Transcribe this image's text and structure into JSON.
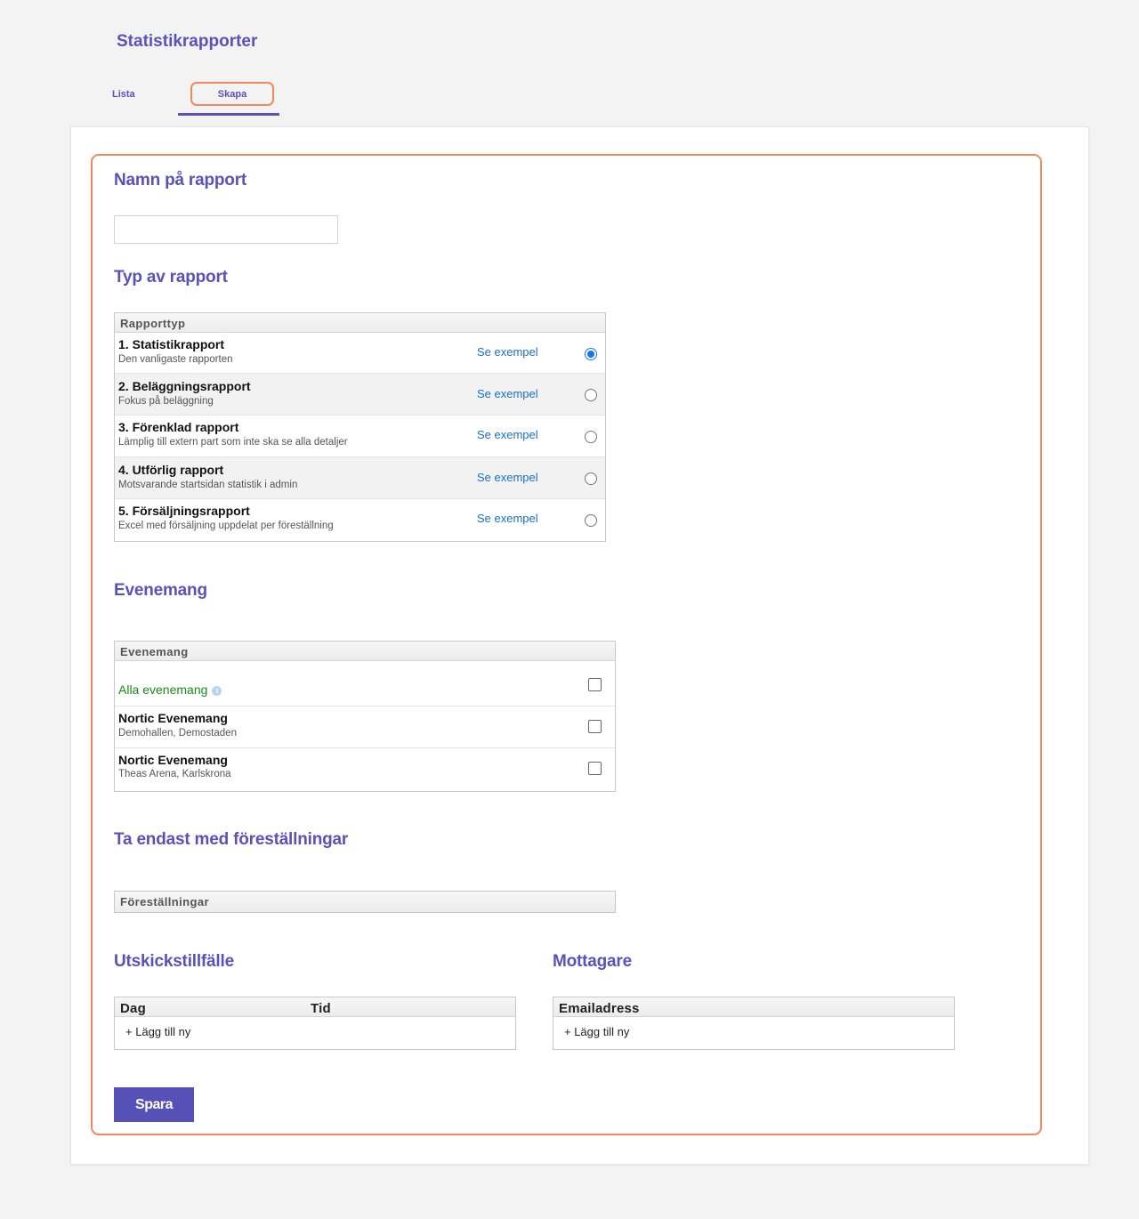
{
  "page": {
    "title": "Statistikrapporter"
  },
  "tabs": [
    {
      "label": "Lista",
      "active": false
    },
    {
      "label": "Skapa",
      "active": true
    }
  ],
  "report_name": {
    "title": "Namn på rapport",
    "value": "",
    "placeholder": ""
  },
  "report_type": {
    "title": "Typ av rapport",
    "column_header": "Rapporttyp",
    "example_label": "Se exempel",
    "items": [
      {
        "title": "1. Statistikrapport",
        "subtitle": "Den vanligaste rapporten",
        "selected": true
      },
      {
        "title": "2. Beläggningsrapport",
        "subtitle": "Fokus på beläggning",
        "selected": false
      },
      {
        "title": "3. Förenklad rapport",
        "subtitle": "Lämplig till extern part som inte ska se alla detaljer",
        "selected": false
      },
      {
        "title": "4. Utförlig rapport",
        "subtitle": "Motsvarande startsidan statistik i admin",
        "selected": false
      },
      {
        "title": "5. Försäljningsrapport",
        "subtitle": "Excel med försäljning uppdelat per föreställning",
        "selected": false
      }
    ]
  },
  "events": {
    "title": "Evenemang",
    "column_header": "Evenemang",
    "all_label": "Alla evenemang",
    "items": [
      {
        "title": "Nortic Evenemang",
        "subtitle": "Demohallen, Demostaden",
        "checked": false
      },
      {
        "title": "Nortic Evenemang",
        "subtitle": "Theas Arena, Karlskrona",
        "checked": false
      }
    ]
  },
  "performances": {
    "title": "Ta endast med föreställningar",
    "column_header": "Föreställningar"
  },
  "schedule": {
    "title": "Utskickstillfälle",
    "col_day": "Dag",
    "col_time": "Tid",
    "add_label": "+ Lägg till ny"
  },
  "recipients": {
    "title": "Mottagare",
    "col_email": "Emailadress",
    "add_label": "+ Lägg till ny"
  },
  "save_label": "Spara",
  "colors": {
    "accent": "#5a52b8",
    "highlight": "#f08a5d",
    "link": "#1a6fc4",
    "all_events": "#1a8a1a"
  }
}
